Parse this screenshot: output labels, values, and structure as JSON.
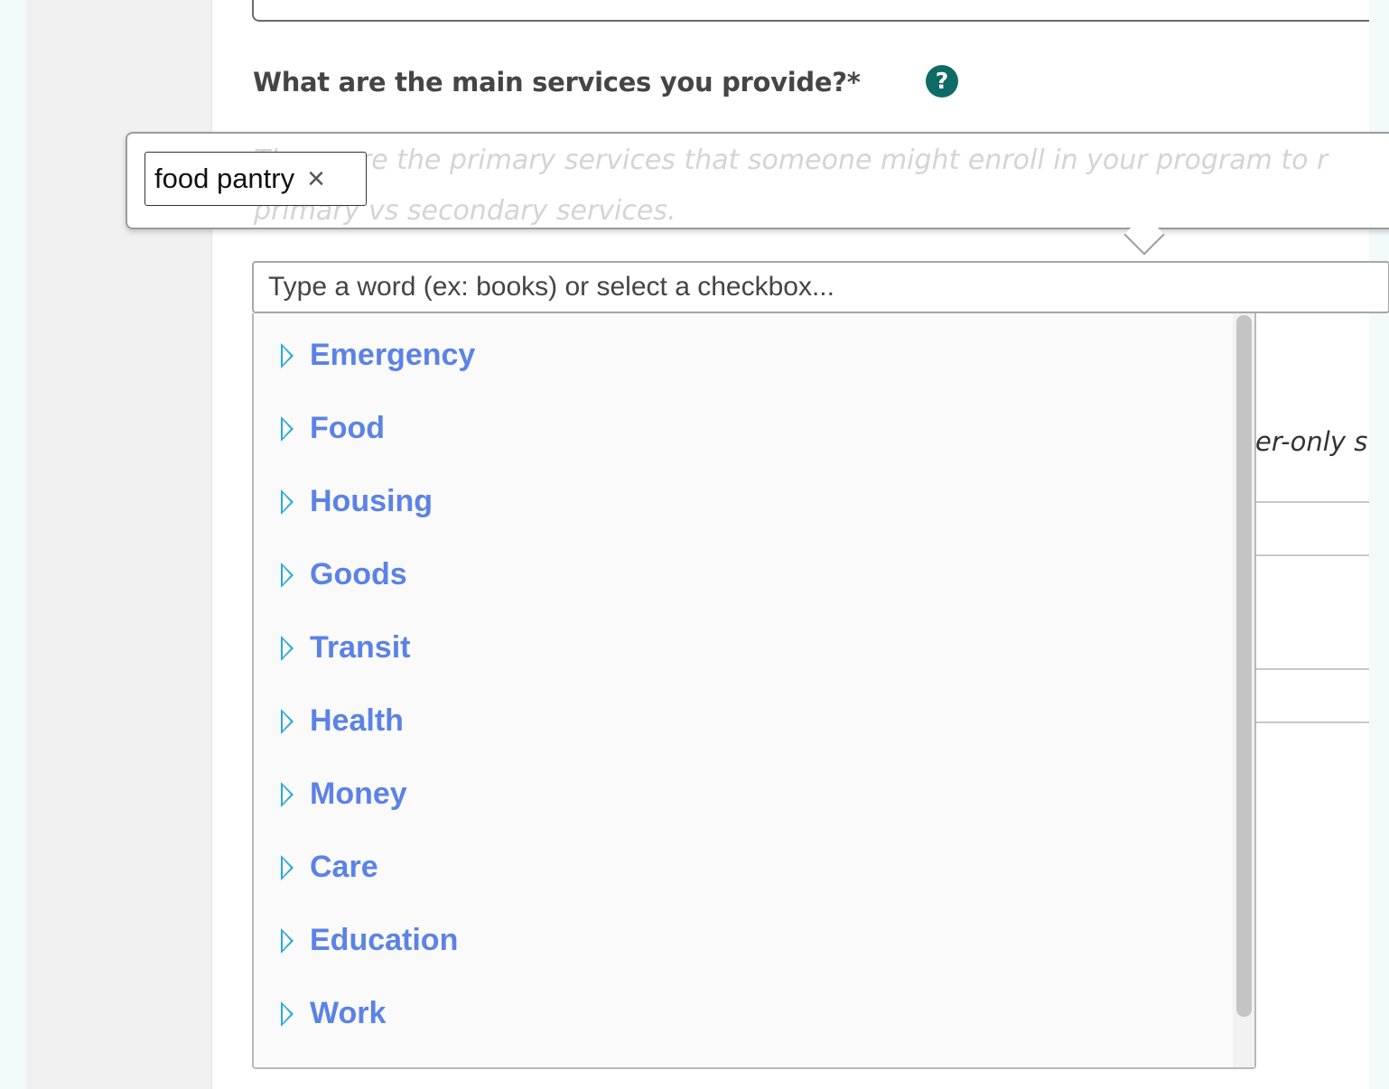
{
  "form": {
    "question": "What are the main services you provide?*",
    "help_icon_glyph": "?",
    "hint": "These are the primary services that someone might enroll in your program to r primary vs secondary services.",
    "background_partial_text": "er-only s"
  },
  "selected_tags": [
    {
      "label": "food pantry",
      "remove_glyph": "×"
    }
  ],
  "search": {
    "placeholder": "Type a word (ex: books) or select a checkbox..."
  },
  "categories": [
    {
      "label": "Emergency"
    },
    {
      "label": "Food"
    },
    {
      "label": "Housing"
    },
    {
      "label": "Goods"
    },
    {
      "label": "Transit"
    },
    {
      "label": "Health"
    },
    {
      "label": "Money"
    },
    {
      "label": "Care"
    },
    {
      "label": "Education"
    },
    {
      "label": "Work"
    }
  ],
  "colors": {
    "category_text": "#5b82e6",
    "category_arrow": "#2aa9d9",
    "help_icon": "#0f6b66",
    "question_text": "#454545"
  },
  "icons": {
    "category_expand": "triangle-right-icon",
    "help": "question-circle-icon",
    "tag_remove": "close-icon"
  }
}
